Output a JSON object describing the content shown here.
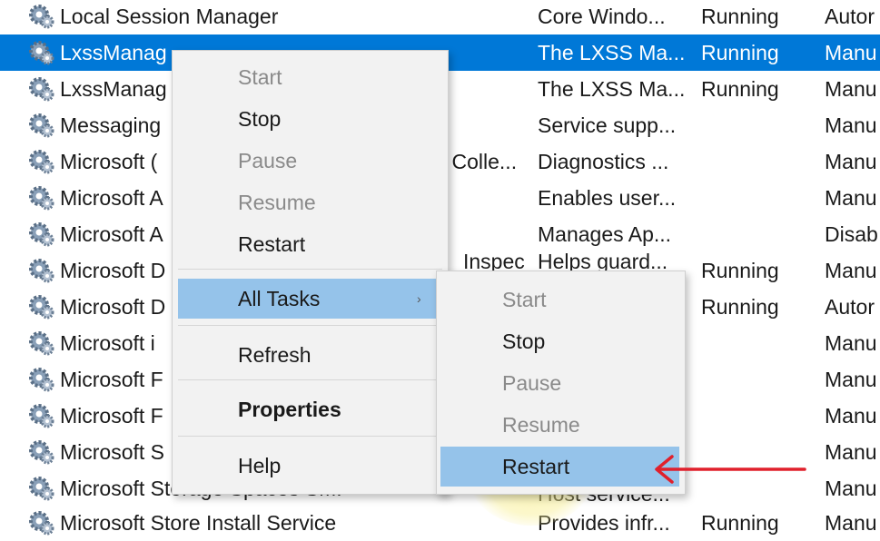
{
  "services": [
    {
      "name": "Local Session Manager",
      "description": "Core Windo...",
      "status": "Running",
      "startup": "Autor"
    },
    {
      "name": "LxssManag",
      "description": "The LXSS Ma...",
      "status": "Running",
      "startup": "Manu"
    },
    {
      "name": "LxssManag",
      "description": "The LXSS Ma...",
      "status": "Running",
      "startup": "Manu"
    },
    {
      "name": "Messaging",
      "description": "Service supp...",
      "status": "",
      "startup": "Manu"
    },
    {
      "name": "Microsoft (",
      "description": "Diagnostics ...",
      "status": "",
      "startup": "Manu"
    },
    {
      "name": "Microsoft A",
      "description": "Enables user...",
      "status": "",
      "startup": "Manu"
    },
    {
      "name": "Microsoft A",
      "description": "Manages Ap...",
      "status": "",
      "startup": "Disab"
    },
    {
      "name": "Microsoft D",
      "description": "",
      "status": "Running",
      "startup": "Manu"
    },
    {
      "name": "Microsoft D",
      "description": "",
      "status": "Running",
      "startup": "Autor"
    },
    {
      "name": "Microsoft i",
      "description": "",
      "status": "",
      "startup": "Manu"
    },
    {
      "name": "Microsoft F",
      "description": "",
      "status": "",
      "startup": "Manu"
    },
    {
      "name": "Microsoft F",
      "description": "",
      "status": "",
      "startup": "Manu"
    },
    {
      "name": "Microsoft S",
      "description": "",
      "status": "",
      "startup": "Manu"
    },
    {
      "name": "Microsoft Storage Spaces SMI",
      "description": "",
      "status": "",
      "startup": "Manu"
    },
    {
      "name": "Microsoft Store Install Service",
      "description": "Provides infr...",
      "status": "Running",
      "startup": "Manu"
    }
  ],
  "partial_text": {
    "colle": "l Colle...",
    "spec": "Inspec",
    "helps_guard": "Helps guard...",
    "host_service": "Host service..."
  },
  "context_menu": {
    "start": "Start",
    "stop": "Stop",
    "pause": "Pause",
    "resume": "Resume",
    "restart": "Restart",
    "all_tasks": "All Tasks",
    "refresh": "Refresh",
    "properties": "Properties",
    "help": "Help"
  },
  "all_tasks_submenu": {
    "start": "Start",
    "stop": "Stop",
    "pause": "Pause",
    "resume": "Resume",
    "restart": "Restart"
  },
  "icons": {
    "service": "gear-icon",
    "submenu": "chevron-right-icon",
    "annotation": "red-arrow-icon"
  },
  "colors": {
    "selection": "#0078d7",
    "menu_highlight": "#95c3ea",
    "disabled_text": "#8a8a8a",
    "annotation_arrow": "#e0202c"
  }
}
